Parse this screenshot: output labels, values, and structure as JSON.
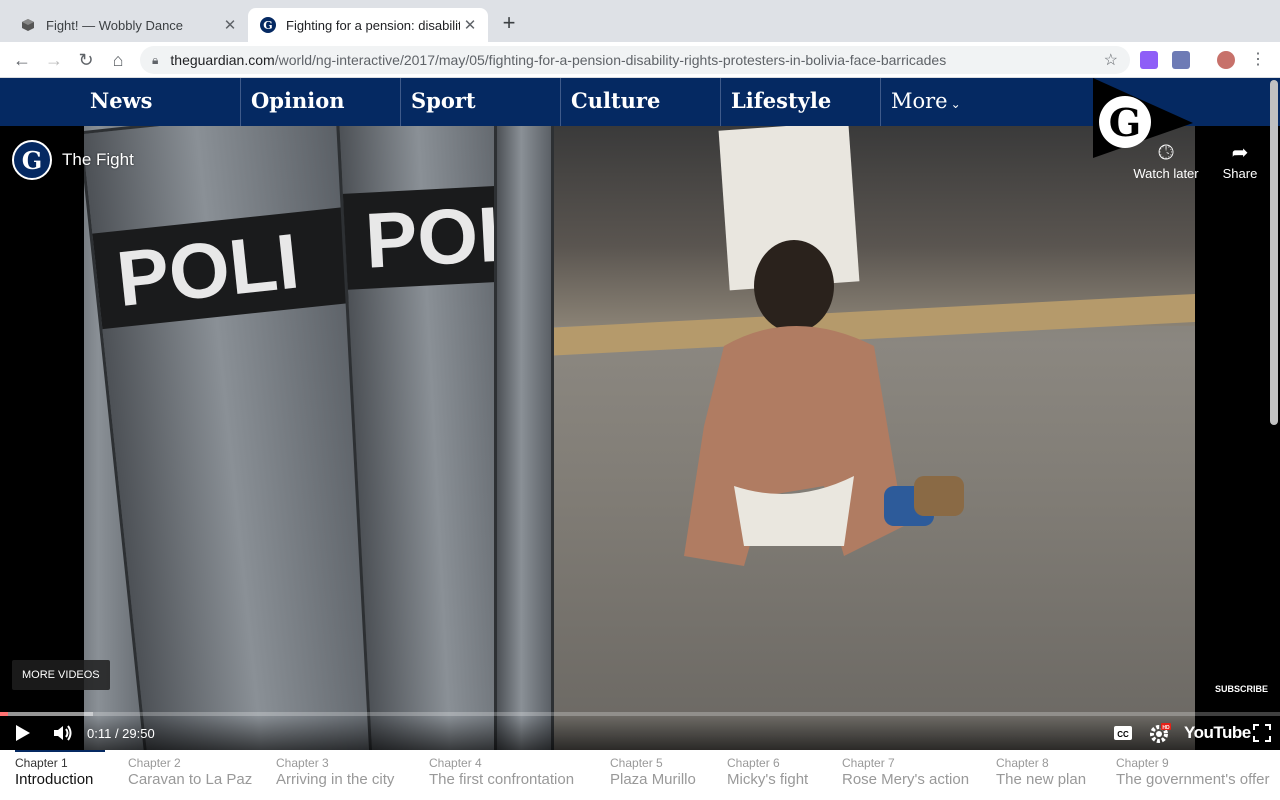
{
  "browser": {
    "tabs": [
      {
        "title": "Fight! — Wobbly Dance",
        "active": false
      },
      {
        "title": "Fighting for a pension: disabilit",
        "active": true
      }
    ],
    "url_host": "theguardian.com",
    "url_path": "/world/ng-interactive/2017/may/05/fighting-for-a-pension-disability-rights-protesters-in-bolivia-face-barricades"
  },
  "nav": {
    "pillars": [
      "News",
      "Opinion",
      "Sport",
      "Culture",
      "Lifestyle"
    ],
    "more_label": "More"
  },
  "video": {
    "title": "The Fight",
    "watch_later": "Watch later",
    "share": "Share",
    "more_videos": "MORE VIDEOS",
    "subscribe": "SUBSCRIBE",
    "time": "0:11 / 29:50",
    "progress_fraction": 0.006,
    "buffered_fraction": 0.073,
    "youtube_label": "YouTube",
    "shield_text": "POLI"
  },
  "chapters": [
    {
      "num": "Chapter 1",
      "name": "Introduction",
      "active": true
    },
    {
      "num": "Chapter 2",
      "name": "Caravan to La Paz",
      "active": false
    },
    {
      "num": "Chapter 3",
      "name": "Arriving in the city",
      "active": false
    },
    {
      "num": "Chapter 4",
      "name": "The first confrontation",
      "active": false
    },
    {
      "num": "Chapter 5",
      "name": "Plaza Murillo",
      "active": false
    },
    {
      "num": "Chapter 6",
      "name": "Micky's fight",
      "active": false
    },
    {
      "num": "Chapter 7",
      "name": "Rose Mery's action",
      "active": false
    },
    {
      "num": "Chapter 8",
      "name": "The new plan",
      "active": false
    },
    {
      "num": "Chapter 9",
      "name": "The government's offer",
      "active": false
    }
  ],
  "colors": {
    "guardian_blue": "#052962",
    "progress_red": "#ff0000"
  }
}
